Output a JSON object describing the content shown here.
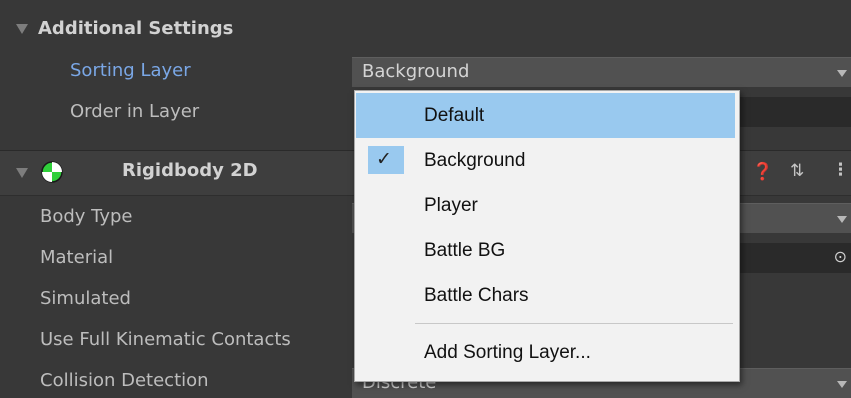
{
  "additional_settings": {
    "title": "Additional Settings",
    "sorting_layer_label": "Sorting Layer",
    "sorting_layer_value": "Background",
    "order_in_layer_label": "Order in Layer"
  },
  "rigidbody": {
    "title": "Rigidbody 2D",
    "props": [
      "Body Type",
      "Material",
      "Simulated",
      "Use Full Kinematic Contacts",
      "Collision Detection"
    ],
    "collision_detection_value": "Discrete"
  },
  "dropdown": {
    "items": [
      "Default",
      "Background",
      "Player",
      "Battle BG",
      "Battle Chars"
    ],
    "highlighted": "Default",
    "checked": "Background",
    "add_label": "Add Sorting Layer..."
  },
  "icons": {
    "collapse": "triangle-down-icon",
    "component": "rigidbody2d-icon",
    "help": "help-icon",
    "presets": "presets-icon",
    "menu": "kebab-menu-icon",
    "picker": "object-picker-icon"
  },
  "colors": {
    "panel": "#383838",
    "accent_label": "#7aa7e6",
    "menu_highlight": "#99c9ef",
    "rigidbody_icon": "#2fcf3a"
  }
}
